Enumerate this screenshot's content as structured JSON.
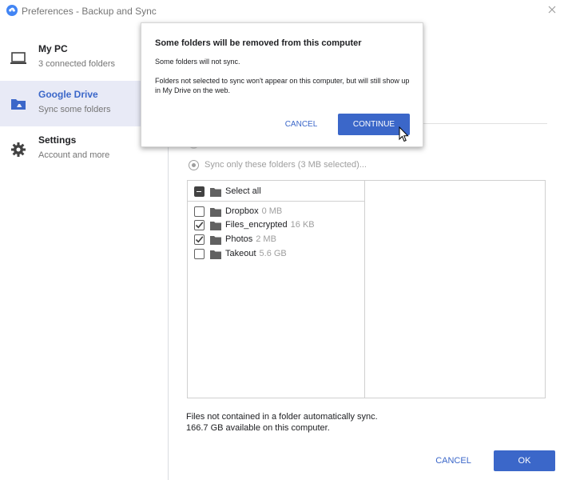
{
  "window": {
    "title": "Preferences - Backup and Sync",
    "accent_color": "#3b67c9"
  },
  "sidebar": {
    "items": [
      {
        "icon": "laptop-icon",
        "title": "My PC",
        "subtitle": "3 connected folders",
        "active": false
      },
      {
        "icon": "drive-folder-icon",
        "title": "Google Drive",
        "subtitle": "Sync some folders",
        "active": true
      },
      {
        "icon": "gear-icon",
        "title": "Settings",
        "subtitle": "Account and more",
        "active": false
      }
    ]
  },
  "sync": {
    "option_label": "Sync only these folders (3 MB selected)...",
    "select_all_label": "Select all",
    "folders": [
      {
        "name": "Dropbox",
        "size": "0 MB",
        "checked": false
      },
      {
        "name": "Files_encrypted",
        "size": "16 KB",
        "checked": true
      },
      {
        "name": "Photos",
        "size": "2 MB",
        "checked": true
      },
      {
        "name": "Takeout",
        "size": "5.6 GB",
        "checked": false
      }
    ]
  },
  "footer": {
    "note_line1": "Files not contained in a folder automatically sync.",
    "note_line2": "166.7 GB available on this computer.",
    "cancel_label": "CANCEL",
    "ok_label": "OK"
  },
  "dialog": {
    "title": "Some folders will be removed from this computer",
    "line1": "Some folders will not sync.",
    "line2": "Folders not selected to sync won't appear on this computer, but will still show up in My Drive on the web.",
    "cancel_label": "CANCEL",
    "continue_label": "CONTINUE"
  }
}
